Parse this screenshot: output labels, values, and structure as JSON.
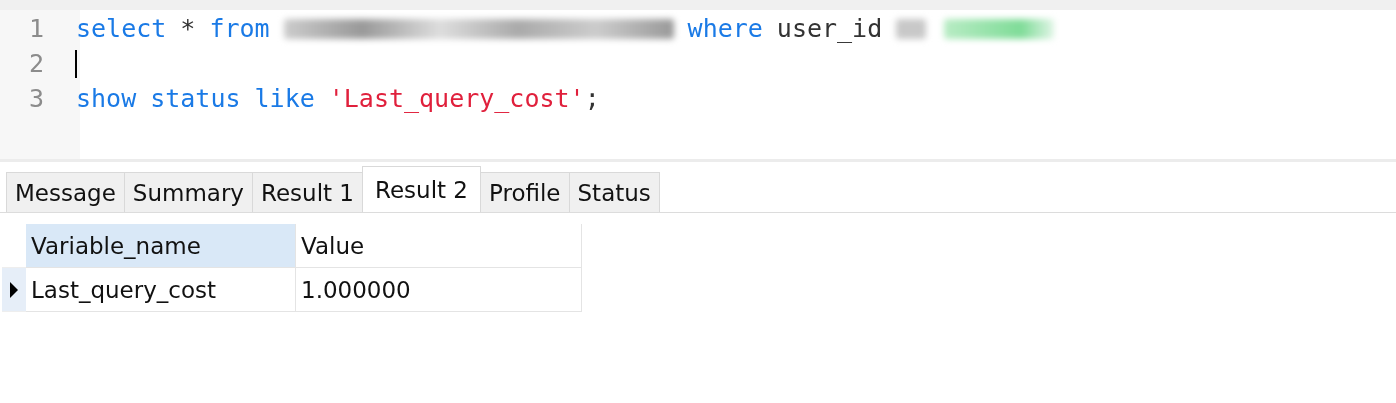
{
  "editor": {
    "lines": [
      {
        "number": "1",
        "tokens": [
          {
            "kind": "keyword",
            "text": "select"
          },
          {
            "kind": "plain",
            "text": "*"
          },
          {
            "kind": "keyword",
            "text": "from"
          },
          {
            "kind": "tablename"
          },
          {
            "kind": "keyword",
            "text": "where"
          },
          {
            "kind": "plain",
            "text": "user_id"
          },
          {
            "kind": "operator"
          },
          {
            "kind": "literal"
          }
        ]
      },
      {
        "number": "2",
        "cursor": true
      },
      {
        "number": "3",
        "tokens": [
          {
            "kind": "keyword",
            "text": "show"
          },
          {
            "kind": "keyword",
            "text": "status"
          },
          {
            "kind": "keyword",
            "text": "like"
          },
          {
            "kind": "string",
            "text": "'Last_query_cost'"
          },
          {
            "kind": "punct",
            "text": ";"
          }
        ]
      }
    ]
  },
  "tabs": [
    {
      "label": "Message",
      "selected": false
    },
    {
      "label": "Summary",
      "selected": false
    },
    {
      "label": "Result 1",
      "selected": false
    },
    {
      "label": "Result 2",
      "selected": true
    },
    {
      "label": "Profile",
      "selected": false
    },
    {
      "label": "Status",
      "selected": false
    }
  ],
  "table": {
    "columns": [
      {
        "label": "Variable_name",
        "selected": true
      },
      {
        "label": "Value",
        "selected": false
      }
    ],
    "rows": [
      {
        "current": true,
        "cells": [
          "Last_query_cost",
          "1.000000"
        ]
      }
    ]
  }
}
